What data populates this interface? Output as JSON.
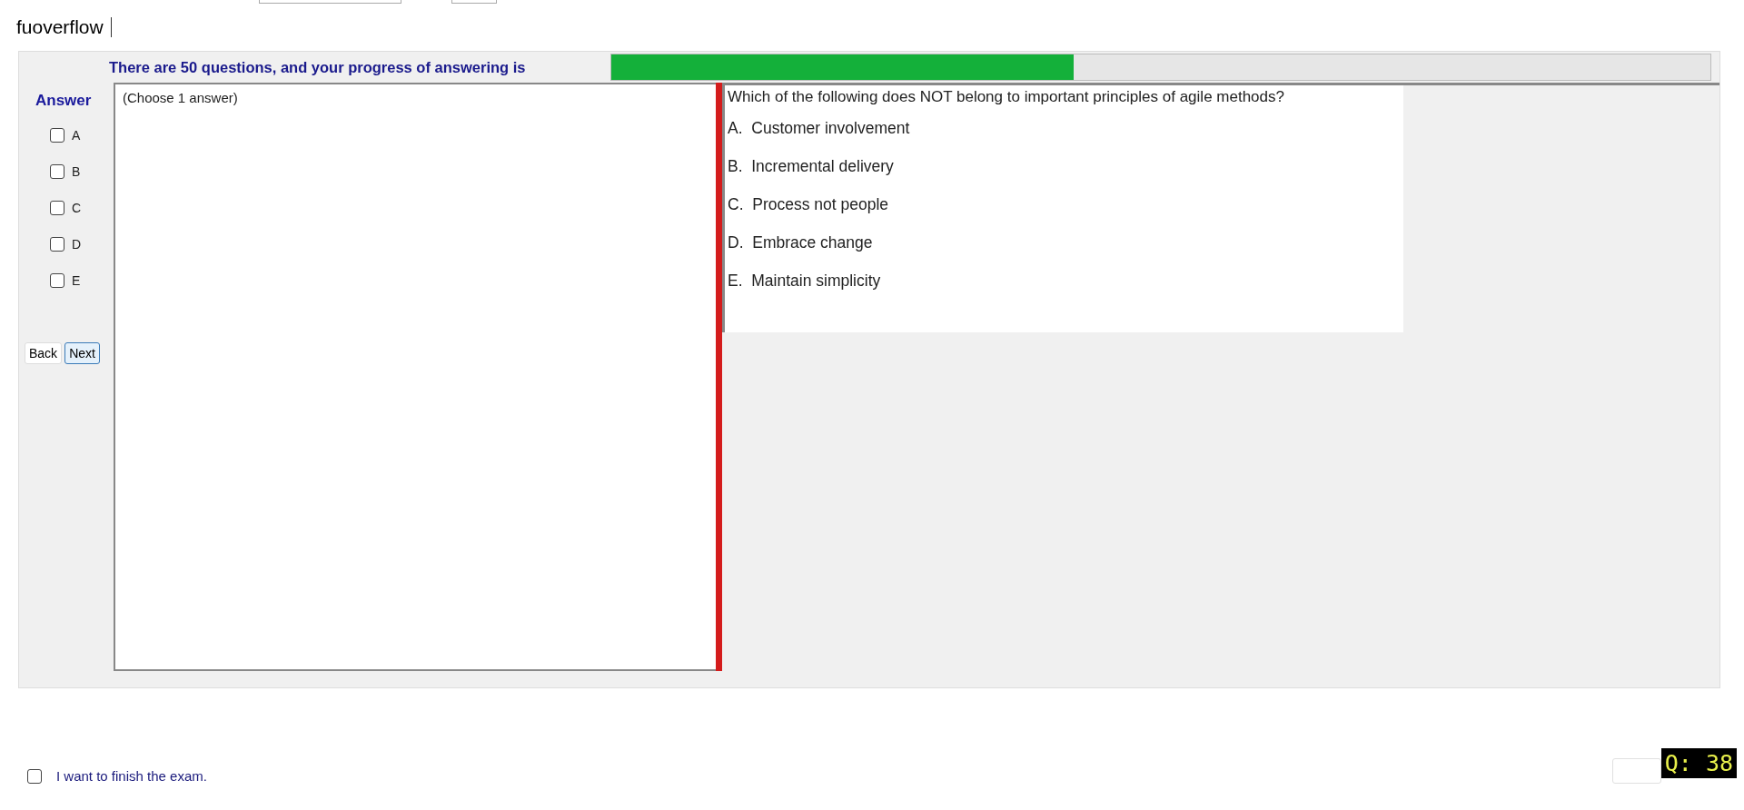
{
  "top_field": {
    "value": "fuoverflow"
  },
  "progress": {
    "label": "There are 50 questions, and your progress of answering is",
    "level": 0.42
  },
  "answer_panel": {
    "title": "Answer",
    "options": [
      {
        "label": "A",
        "checked": false
      },
      {
        "label": "B",
        "checked": false
      },
      {
        "label": "C",
        "checked": false
      },
      {
        "label": "D",
        "checked": false
      },
      {
        "label": "E",
        "checked": false
      }
    ],
    "buttons": [
      {
        "label": "Back",
        "focused": false
      },
      {
        "label": "Next",
        "focused": true
      }
    ]
  },
  "answer_box": {
    "hint": "(Choose 1 answer)"
  },
  "question": {
    "text": "Which of the following does NOT belong to important principles of agile methods?",
    "choices": [
      "A.  Customer involvement",
      "B.  Incremental delivery",
      "C.  Process not people",
      "D.  Embrace change",
      "E.  Maintain simplicity"
    ]
  },
  "finish": {
    "label": "I want to finish the exam.",
    "checked": false
  },
  "question_badge": "Q: 38"
}
